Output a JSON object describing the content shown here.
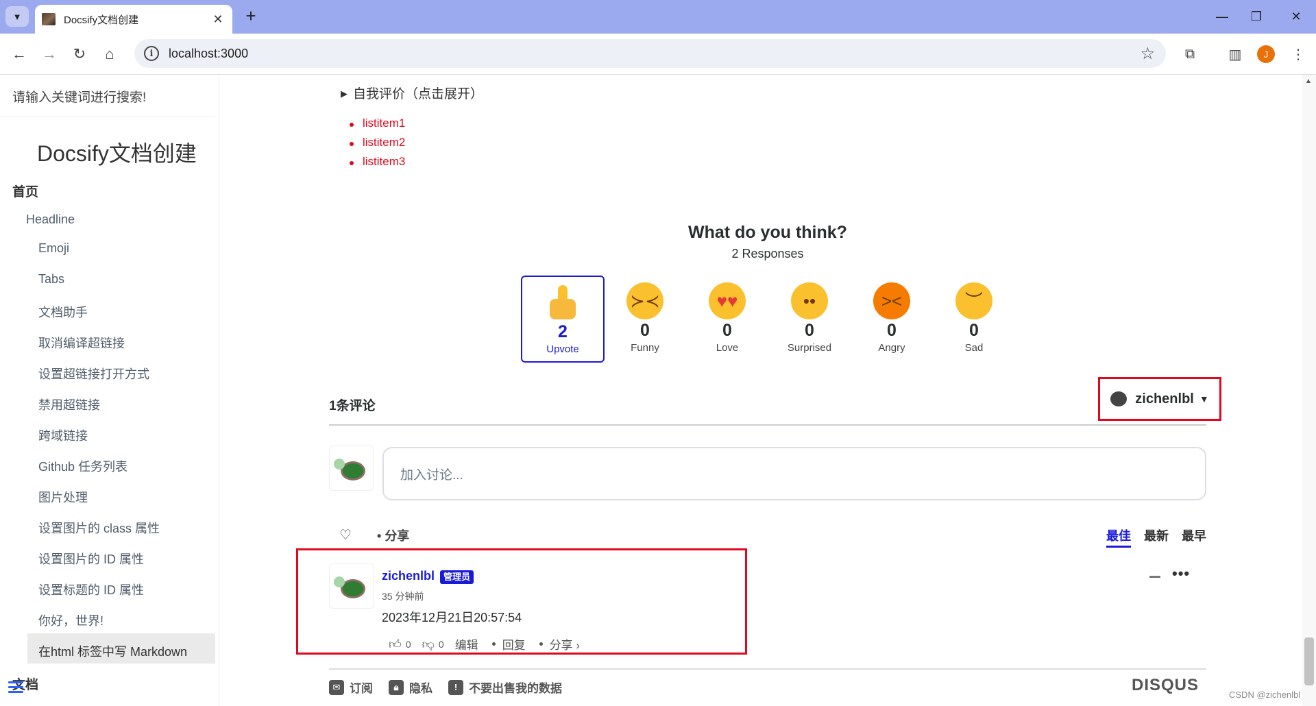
{
  "browser": {
    "tab_title": "Docsify文档创建",
    "tab_close": "✕",
    "new_tab": "+",
    "url": "localhost:3000",
    "profile_initial": "J"
  },
  "sidebar": {
    "search_placeholder": "请输入关键词进行搜索!",
    "app_name": "Docsify文档创建",
    "home": "首页",
    "headline": "Headline",
    "items": [
      "Emoji",
      "Tabs",
      "文档助手",
      "取消编译超链接",
      "设置超链接打开方式",
      "禁用超链接",
      "跨域链接",
      "Github 任务列表",
      "图片处理",
      "设置图片的 class 属性",
      "设置图片的 ID 属性",
      "设置标题的 ID 属性",
      "你好，世界!",
      "在html 标签中写 Markdown"
    ],
    "bottom": "文档"
  },
  "content": {
    "details_summary": "自我评价（点击展开）",
    "list_items": [
      "listitem1",
      "listitem2",
      "listitem3"
    ]
  },
  "disqus": {
    "question": "What do you think?",
    "responses": "2 Responses",
    "reactions": [
      {
        "label": "Upvote",
        "count": "2",
        "icon": "thumbs-up"
      },
      {
        "label": "Funny",
        "count": "0",
        "icon": "laughing-face"
      },
      {
        "label": "Love",
        "count": "0",
        "icon": "heart-eyes-face"
      },
      {
        "label": "Surprised",
        "count": "0",
        "icon": "surprised-face"
      },
      {
        "label": "Angry",
        "count": "0",
        "icon": "angry-face"
      },
      {
        "label": "Sad",
        "count": "0",
        "icon": "sad-face"
      }
    ],
    "comment_count": "1条评论",
    "username": "zichenlbl",
    "composer_placeholder": "加入讨论...",
    "share": "分享",
    "sort": [
      "最佳",
      "最新",
      "最早"
    ],
    "comment": {
      "author": "zichenlbl",
      "badge": "管理员",
      "time": "35 分钟前",
      "text": "2023年12月21日20:57:54",
      "upvotes": "0",
      "downvotes": "0",
      "edit": "编辑",
      "reply": "回复",
      "share": "分享 ›"
    },
    "footer": {
      "subscribe": "订阅",
      "privacy": "隐私",
      "do_not_sell": "不要出售我的数据",
      "logo": "DISQUS"
    }
  },
  "watermark": "CSDN @zichenlbl",
  "colors": {
    "tabbar": "#9ba9ef",
    "accent_blue": "#1a1ad9",
    "highlight_red": "#e3071d",
    "list_red": "#e3071d"
  }
}
